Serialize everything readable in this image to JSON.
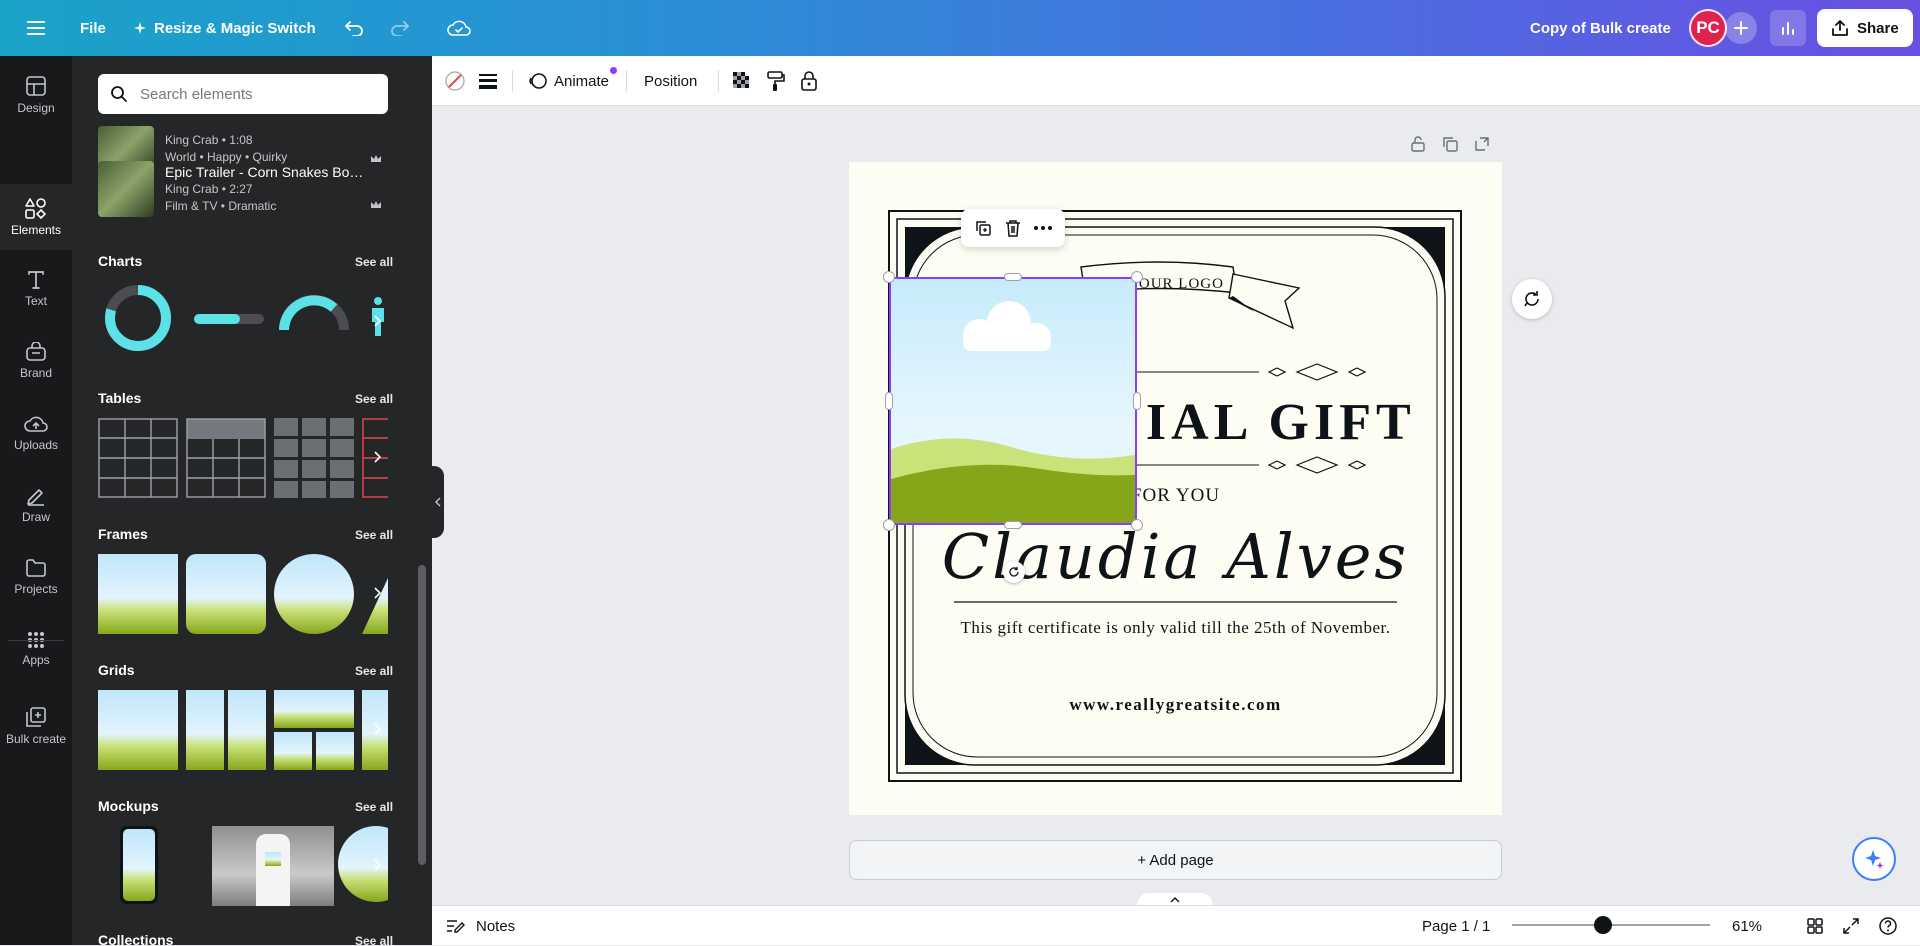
{
  "topbar": {
    "file_label": "File",
    "resize_label": "Resize & Magic Switch",
    "doc_title": "Copy of Bulk create",
    "avatar_initials": "PC",
    "share_label": "Share"
  },
  "rail": {
    "items": [
      {
        "label": "Design",
        "icon": "design-icon"
      },
      {
        "label": "Elements",
        "icon": "elements-icon"
      },
      {
        "label": "Text",
        "icon": "text-icon"
      },
      {
        "label": "Brand",
        "icon": "brand-icon"
      },
      {
        "label": "Uploads",
        "icon": "uploads-icon"
      },
      {
        "label": "Draw",
        "icon": "draw-icon"
      },
      {
        "label": "Projects",
        "icon": "projects-icon"
      },
      {
        "label": "Apps",
        "icon": "apps-icon"
      },
      {
        "label": "Bulk create",
        "icon": "bulk-create-icon"
      }
    ]
  },
  "panel": {
    "search_placeholder": "Search elements",
    "audio": [
      {
        "title": "",
        "meta": "King Crab • 1:08",
        "tags": "World • Happy • Quirky"
      },
      {
        "title": "Epic Trailer - Corn Snakes Bour...",
        "meta": "King Crab • 2:27",
        "tags": "Film & TV • Dramatic"
      }
    ],
    "sections": {
      "charts": "Charts",
      "tables": "Tables",
      "frames": "Frames",
      "grids": "Grids",
      "mockups": "Mockups",
      "collections": "Collections"
    },
    "see_all": "See all"
  },
  "edit_bar": {
    "animate_label": "Animate",
    "position_label": "Position"
  },
  "certificate": {
    "logo_text": "YOUR LOGO",
    "heading": "A SPECIAL GIFT",
    "for_you": "FOR YOU",
    "recipient": "Claudia Alves",
    "validity": "This gift certificate is only valid till the 25th of November.",
    "website": "www.reallygreatsite.com"
  },
  "canvas": {
    "add_page_label": "+ Add page"
  },
  "bottom_bar": {
    "notes_label": "Notes",
    "page_indicator": "Page 1 / 1",
    "zoom_label": "61%",
    "zoom_value": 61
  },
  "colors": {
    "selection": "#8b3dff",
    "avatar": "#e0234e",
    "rail_bg": "#18191b",
    "panel_bg": "#252627",
    "page_bg": "#fdfdf3",
    "accent_teal": "#5ce1e6"
  }
}
